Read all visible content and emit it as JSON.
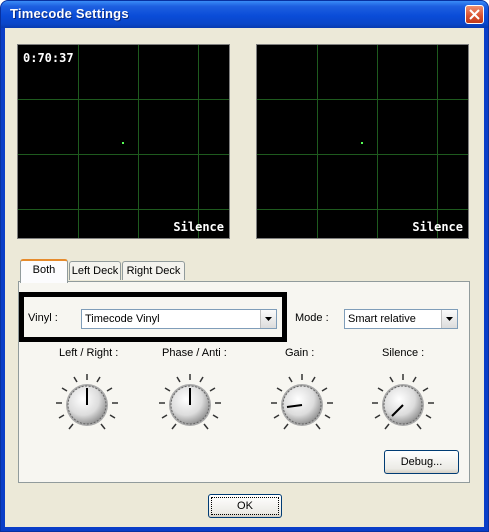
{
  "window": {
    "title": "Timecode Settings"
  },
  "scopes": [
    {
      "readout": "0:70:37",
      "status": "Silence"
    },
    {
      "readout": "",
      "status": "Silence"
    }
  ],
  "tabs": [
    {
      "label": "Both",
      "active": true
    },
    {
      "label": "Left Deck",
      "active": false
    },
    {
      "label": "Right Deck",
      "active": false
    }
  ],
  "vinyl": {
    "label": "Vinyl :",
    "value": "Timecode Vinyl"
  },
  "mode": {
    "label": "Mode :",
    "value": "Smart relative"
  },
  "knobs": [
    {
      "label": "Left / Right :"
    },
    {
      "label": "Phase / Anti :"
    },
    {
      "label": "Gain :"
    },
    {
      "label": "Silence :"
    }
  ],
  "buttons": {
    "debug": "Debug...",
    "ok": "OK"
  },
  "colors": {
    "titlebar": "#0a4cd8",
    "scope_bg": "#000000",
    "scope_grid": "#1e5a1e",
    "tab_accent": "#e68b2c",
    "close": "#d9502e"
  }
}
